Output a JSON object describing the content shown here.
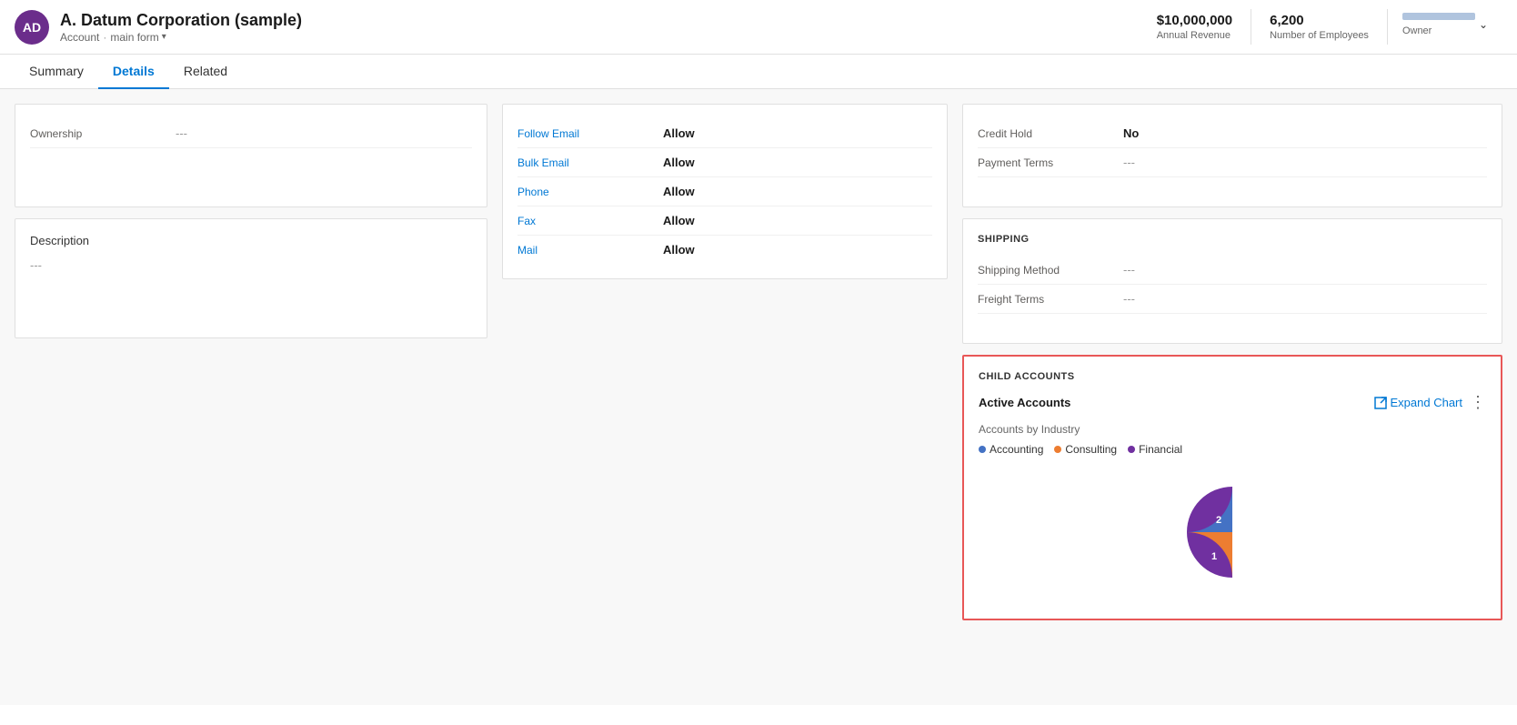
{
  "header": {
    "avatar_initials": "AD",
    "title": "A. Datum Corporation (sample)",
    "subtitle_type": "Account",
    "subtitle_form": "main form",
    "annual_revenue_label": "Annual Revenue",
    "annual_revenue_value": "$10,000,000",
    "employees_label": "Number of Employees",
    "employees_value": "6,200",
    "owner_label": "Owner",
    "owner_value": ""
  },
  "tabs": [
    {
      "id": "summary",
      "label": "Summary",
      "active": false
    },
    {
      "id": "details",
      "label": "Details",
      "active": true
    },
    {
      "id": "related",
      "label": "Related",
      "active": false
    }
  ],
  "left_column": {
    "ownership_label": "Ownership",
    "ownership_value": "---",
    "description_title": "Description",
    "description_value": "---"
  },
  "middle_column": {
    "fields": [
      {
        "label": "Follow Email",
        "value": "Allow",
        "label_blue": true
      },
      {
        "label": "Bulk Email",
        "value": "Allow",
        "label_blue": true
      },
      {
        "label": "Phone",
        "value": "Allow",
        "label_blue": true
      },
      {
        "label": "Fax",
        "value": "Allow",
        "label_blue": true
      },
      {
        "label": "Mail",
        "value": "Allow",
        "label_blue": true
      }
    ]
  },
  "right_column": {
    "credit_hold_label": "Credit Hold",
    "credit_hold_value": "No",
    "payment_terms_label": "Payment Terms",
    "payment_terms_value": "---",
    "shipping_section_title": "SHIPPING",
    "shipping_method_label": "Shipping Method",
    "shipping_method_value": "---",
    "freight_terms_label": "Freight Terms",
    "freight_terms_value": "---",
    "child_accounts_title": "CHILD ACCOUNTS",
    "active_accounts_label": "Active Accounts",
    "expand_chart_label": "Expand Chart",
    "accounts_by_industry_label": "Accounts by Industry",
    "legend": [
      {
        "label": "Accounting",
        "color": "#4472c4"
      },
      {
        "label": "Consulting",
        "color": "#ed7d31"
      },
      {
        "label": "Financial",
        "color": "#7030a0"
      }
    ],
    "pie_data": [
      {
        "label": "Financial",
        "value": 2,
        "color": "#7030a0",
        "start_angle": 0,
        "end_angle": 180
      },
      {
        "label": "Consulting",
        "value": 1,
        "color": "#ed7d31",
        "start_angle": 180,
        "end_angle": 270
      },
      {
        "label": "Accounting",
        "value": 1,
        "color": "#4472c4",
        "start_angle": 270,
        "end_angle": 360
      }
    ]
  }
}
